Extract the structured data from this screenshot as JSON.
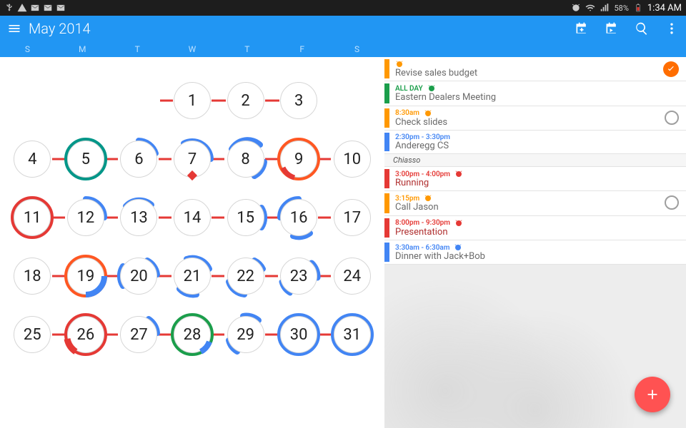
{
  "status_bar": {
    "battery_pct": "58%",
    "time": "1:34 AM"
  },
  "app_bar": {
    "title": "May 2014"
  },
  "weekdays": [
    "S",
    "M",
    "T",
    "W",
    "T",
    "F",
    "S"
  ],
  "calendar": {
    "month": "May",
    "year": 2014,
    "rows": [
      [
        null,
        null,
        null,
        1,
        2,
        3,
        null
      ],
      [
        4,
        5,
        6,
        7,
        8,
        9,
        10
      ],
      [
        11,
        12,
        13,
        14,
        15,
        16,
        17
      ],
      [
        18,
        19,
        20,
        21,
        22,
        23,
        24
      ],
      [
        25,
        26,
        27,
        28,
        29,
        30,
        31
      ]
    ],
    "first_row": [
      null,
      null,
      null,
      1,
      2,
      3
    ],
    "rings": {
      "5": "teal",
      "9": "orange",
      "11": "red",
      "19": "orange",
      "26": "red",
      "28": "green",
      "30": "blue",
      "31": "blue"
    }
  },
  "colors": {
    "blue": "#4285F4",
    "red": "#E53935",
    "orange": "#FF9800",
    "deep_orange": "#FF5722",
    "green": "#1B9E4B",
    "teal": "#009688"
  },
  "agenda": [
    {
      "stripe": "#FF9800",
      "time": "",
      "time_color": "",
      "title": "Revise sales budget",
      "alarm": "#FF9800",
      "control": "check"
    },
    {
      "stripe": "#1B9E4B",
      "time": "ALL DAY",
      "time_color": "#1B9E4B",
      "title": "Eastern Dealers Meeting",
      "alarm": "#1B9E4B"
    },
    {
      "stripe": "#FF9800",
      "time": "8:30am",
      "time_color": "#FF9800",
      "title": "Check slides",
      "alarm": "#FF9800",
      "control": "circle"
    },
    {
      "stripe": "#4285F4",
      "time": "2:30pm - 3:30pm",
      "time_color": "#4285F4",
      "title": "Anderegg CS"
    },
    {
      "group": "Chiasso"
    },
    {
      "stripe": "#E53935",
      "time": "3:00pm - 4:00pm",
      "time_color": "#E53935",
      "title": "Running",
      "title_red": true,
      "alarm": "#E53935"
    },
    {
      "stripe": "#FF9800",
      "time": "3:15pm",
      "time_color": "#FF9800",
      "title": "Call Jason",
      "alarm": "#FF9800",
      "control": "circle"
    },
    {
      "stripe": "#E53935",
      "time": "8:00pm - 9:30pm",
      "time_color": "#E53935",
      "title": "Presentation",
      "title_red": true,
      "alarm": "#E53935"
    },
    {
      "stripe": "#4285F4",
      "time": "3:30am - 6:30am",
      "time_color": "#4285F4",
      "title": "Dinner with Jack+Bob",
      "alarm": "#4285F4"
    }
  ]
}
